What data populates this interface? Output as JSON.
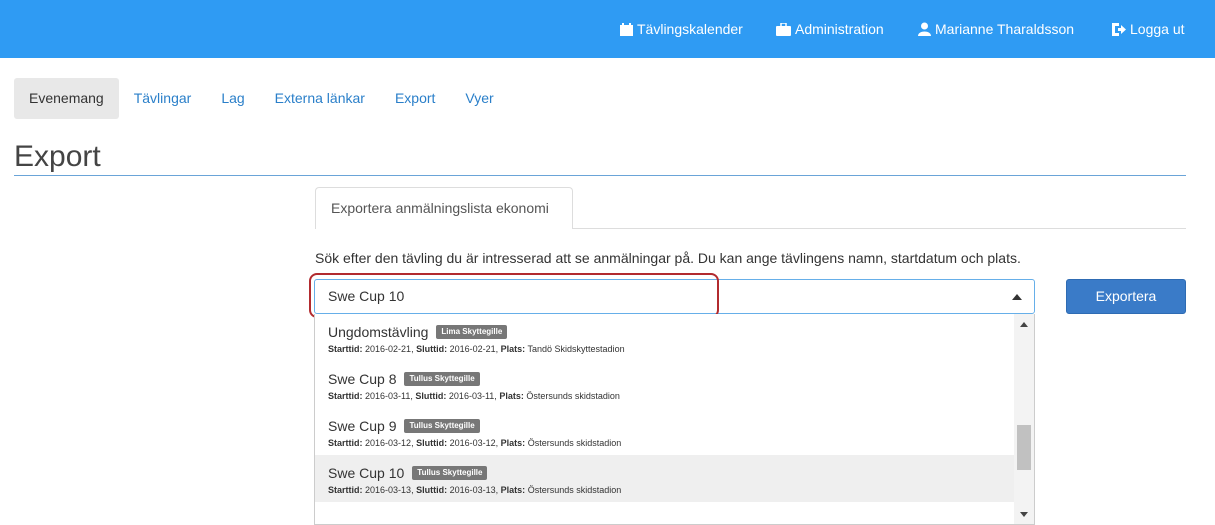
{
  "colors": {
    "topbar": "#2f9bf3",
    "accent_link": "#2a7fc9",
    "button": "#3a7bc8",
    "highlight": "#b22b2f"
  },
  "topnav": {
    "calendar": {
      "icon": "calendar-icon",
      "label": "Tävlingskalender"
    },
    "administration": {
      "icon": "briefcase-icon",
      "label": "Administration"
    },
    "user": {
      "icon": "user-icon",
      "label": "Marianne Tharaldsson"
    },
    "logout": {
      "icon": "logout-icon",
      "label": "Logga ut"
    }
  },
  "subnav": [
    "Evenemang",
    "Tävlingar",
    "Lag",
    "Externa länkar",
    "Export",
    "Vyer"
  ],
  "page_title": "Export",
  "tab_label": "Exportera anmälningslista ekonomi",
  "help_text": "Sök efter den tävling du är intresserad att se anmälningar på. Du kan ange tävlingens namn, startdatum och plats.",
  "search": {
    "value": "Swe Cup 10"
  },
  "export_button": "Exportera",
  "labels": {
    "start": "Starttid:",
    "end": "Sluttid:",
    "place": "Plats:"
  },
  "options": [
    {
      "name": "Ungdomstävling",
      "club": "Lima Skyttegille",
      "start": "2016-02-21",
      "end": "2016-02-21",
      "place": "Tandö Skidskyttestadion",
      "selected": false
    },
    {
      "name": "Swe Cup 8",
      "club": "Tullus Skyttegille",
      "start": "2016-03-11",
      "end": "2016-03-11",
      "place": "Östersunds skidstadion",
      "selected": false
    },
    {
      "name": "Swe Cup 9",
      "club": "Tullus Skyttegille",
      "start": "2016-03-12",
      "end": "2016-03-12",
      "place": "Östersunds skidstadion",
      "selected": false
    },
    {
      "name": "Swe Cup 10",
      "club": "Tullus Skyttegille",
      "start": "2016-03-13",
      "end": "2016-03-13",
      "place": "Östersunds skidstadion",
      "selected": true
    }
  ]
}
